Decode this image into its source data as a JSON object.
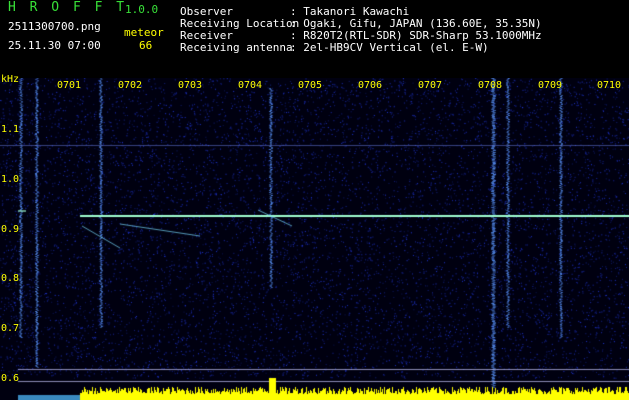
{
  "header": {
    "app_title": "H R O F F T",
    "version": "1.0.0",
    "filename": "2511300700.png",
    "datetime": "25.11.30 07:00",
    "meteor_label": "meteor",
    "meteor_count": "66",
    "info_labels": [
      "Observer",
      "Receiving Location",
      "Receiver",
      "Receiving antenna"
    ],
    "info_values": [
      ": Takanori Kawachi",
      ": Ogaki, Gifu, JAPAN (136.60E, 35.35N)",
      ": R820T2(RTL-SDR) SDR-Sharp 53.1000MHz",
      ": 2el-HB9CV Vertical (el. E-W)"
    ]
  },
  "axis": {
    "unit": "kHz",
    "y_labels": [
      "1.1",
      "1.0",
      "0.9",
      "0.8",
      "0.7",
      "0.6"
    ],
    "time_labels": [
      "0701",
      "0702",
      "0703",
      "0704",
      "0705",
      "0706",
      "0707",
      "0708",
      "0709",
      "0710"
    ]
  },
  "colors": {
    "background": "#000010",
    "noise": "#1a2a8a",
    "label": "#ffff00",
    "carrier": "#a0ffd0",
    "bars": "#ffff00"
  }
}
